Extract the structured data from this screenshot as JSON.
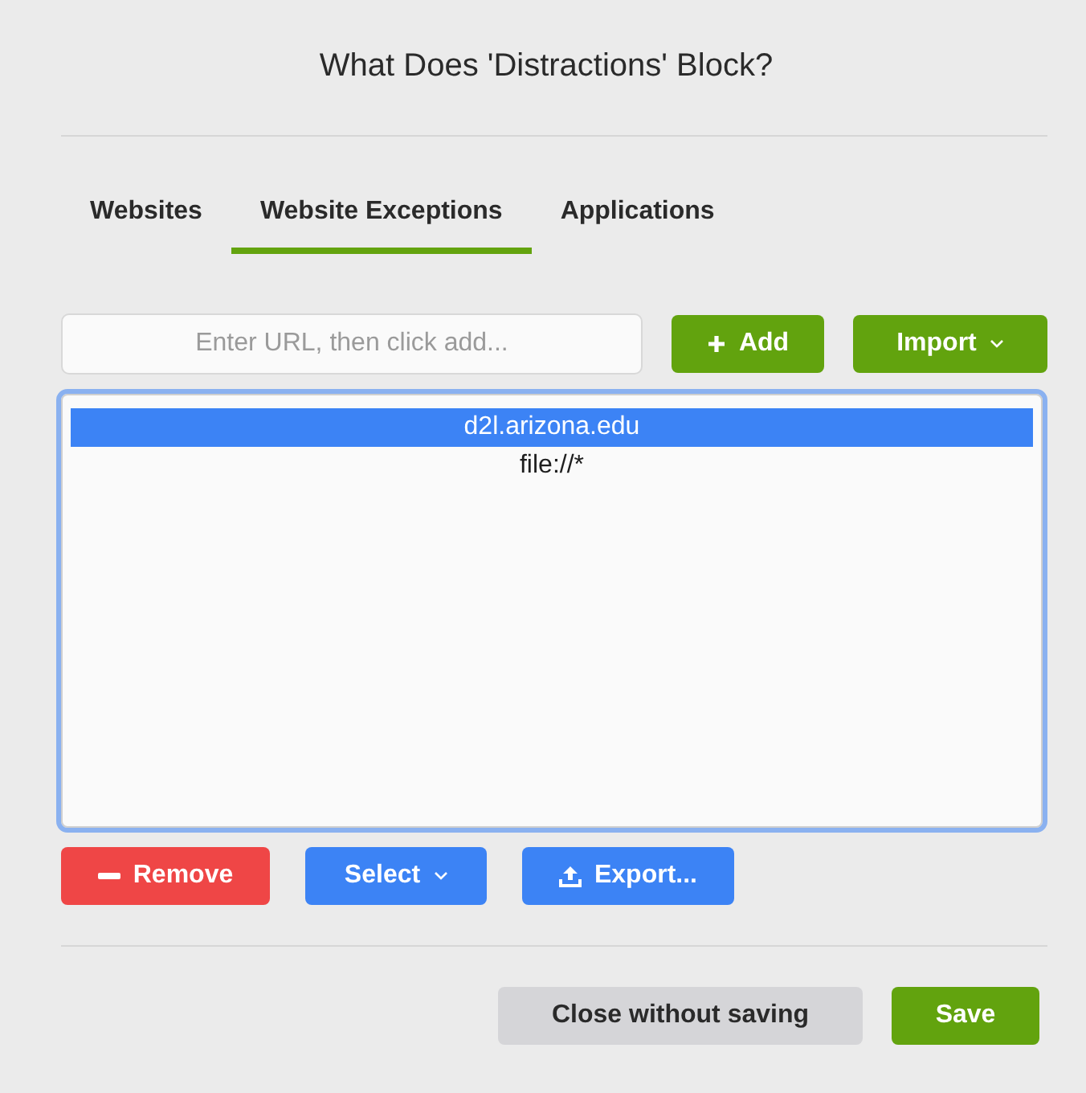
{
  "dialog": {
    "title": "What Does 'Distractions' Block?"
  },
  "tabs": [
    {
      "label": "Websites",
      "selected": false
    },
    {
      "label": "Website Exceptions",
      "selected": true
    },
    {
      "label": "Applications",
      "selected": false
    }
  ],
  "url_field": {
    "placeholder": "Enter URL, then click add..."
  },
  "add_button": {
    "label": "Add"
  },
  "import_button": {
    "label": "Import"
  },
  "exceptions": [
    {
      "label": "d2l.arizona.edu",
      "selected": true
    },
    {
      "label": "file://*",
      "selected": false
    }
  ],
  "list_actions": [
    {
      "kind": "remove",
      "label": "Remove"
    },
    {
      "kind": "select",
      "label": "Select"
    },
    {
      "kind": "export",
      "label": "Export..."
    }
  ],
  "footer_buttons": [
    {
      "kind": "cancel",
      "label": "Close without saving"
    },
    {
      "kind": "save",
      "label": "Save"
    }
  ]
}
